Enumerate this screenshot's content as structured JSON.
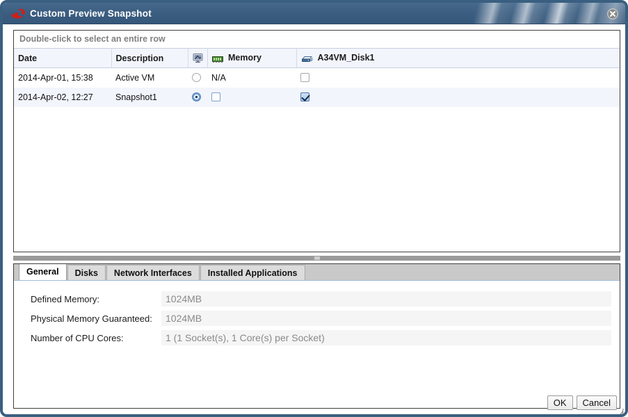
{
  "window": {
    "title": "Custom Preview Snapshot",
    "icon": "redhat-shadowman-icon",
    "close_label": "×",
    "accent_color": "#3e6286",
    "border_color": "#3a5f80"
  },
  "table": {
    "hint": "Double-click to select an entire row",
    "columns": [
      {
        "label": "Date",
        "icon": null
      },
      {
        "label": "Description",
        "icon": null
      },
      {
        "label": "",
        "icon": "monitor-icon"
      },
      {
        "label": "Memory",
        "icon": "memory-stick-icon"
      },
      {
        "label": "A34VM_Disk1",
        "icon": "disk-drive-icon"
      }
    ],
    "rows": [
      {
        "date": "2014-Apr-01, 15:38",
        "description": "Active VM",
        "radio_selected": false,
        "memory_text": "N/A",
        "memory_checkbox": null,
        "disk_checked": false,
        "disk_checkbox_style": "off-gray"
      },
      {
        "date": "2014-Apr-02, 12:27",
        "description": "Snapshot1",
        "radio_selected": true,
        "memory_text": "",
        "memory_checkbox": "off-blue",
        "disk_checked": true,
        "disk_checkbox_style": "on-blue"
      }
    ]
  },
  "tabs": [
    {
      "label": "General",
      "active": true
    },
    {
      "label": "Disks",
      "active": false
    },
    {
      "label": "Network Interfaces",
      "active": false
    },
    {
      "label": "Installed Applications",
      "active": false
    }
  ],
  "general_tab": {
    "fields": [
      {
        "label": "Defined Memory:",
        "value": "1024MB"
      },
      {
        "label": "Physical Memory Guaranteed:",
        "value": "1024MB"
      },
      {
        "label": "Number of CPU Cores:",
        "value": "1 (1 Socket(s), 1 Core(s) per Socket)"
      }
    ]
  },
  "footer": {
    "ok_label": "OK",
    "cancel_label": "Cancel"
  }
}
